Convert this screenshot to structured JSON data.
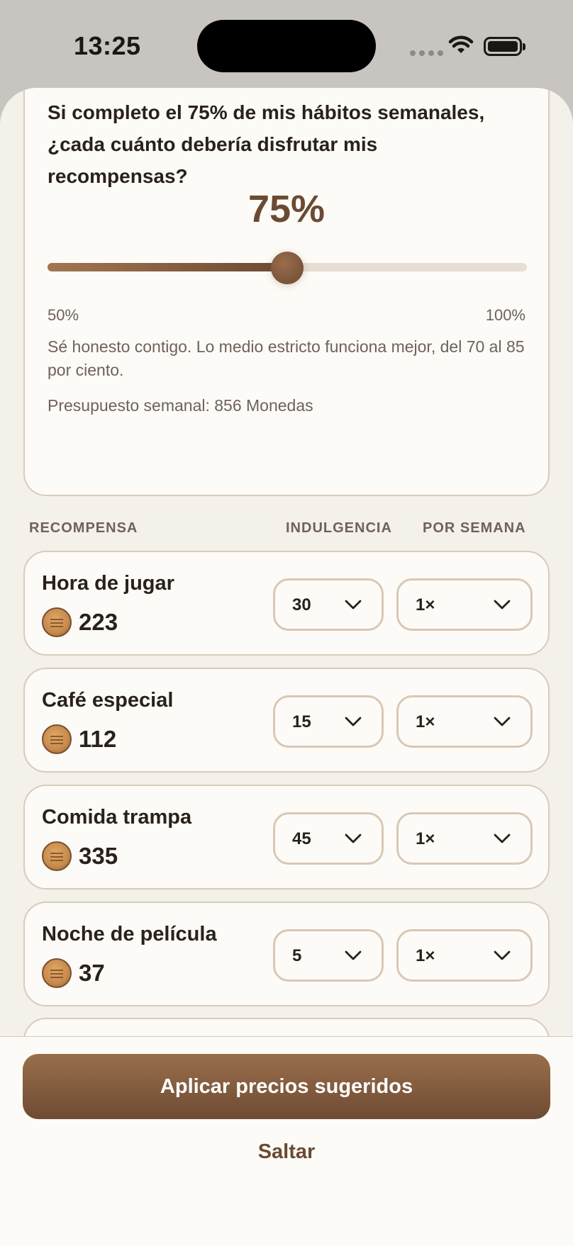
{
  "status_bar": {
    "time": "13:25"
  },
  "question_card": {
    "question": "Si completo el 75% de mis hábitos semanales, ¿cada cuánto debería disfrutar mis recompensas?",
    "percent_label": "75%",
    "slider": {
      "value": 75,
      "min": 50,
      "max": 100,
      "min_label": "50%",
      "max_label": "100%"
    },
    "hint": "Sé honesto contigo. Lo medio estricto funciona mejor, del 70 al 85 por ciento.",
    "budget": "Presupuesto semanal: 856 Monedas"
  },
  "table_headers": {
    "reward": "RECOMPENSA",
    "indulgence": "INDULGENCIA",
    "per_week": "POR SEMANA"
  },
  "rewards": [
    {
      "name": "Hora de jugar",
      "cost": "223",
      "indulgence": "30",
      "per_week": "1×"
    },
    {
      "name": "Café especial",
      "cost": "112",
      "indulgence": "15",
      "per_week": "1×"
    },
    {
      "name": "Comida trampa",
      "cost": "335",
      "indulgence": "45",
      "per_week": "1×"
    },
    {
      "name": "Noche de película",
      "cost": "37",
      "indulgence": "5",
      "per_week": "1×"
    }
  ],
  "actions": {
    "apply_label": "Aplicar precios sugeridos",
    "skip_label": "Saltar"
  },
  "colors": {
    "accent": "#6b4a33",
    "background": "#f4f0ea",
    "card": "#fdfbf7",
    "border": "#d9cbbb"
  },
  "icons": [
    "wifi-icon",
    "battery-icon",
    "coin-icon",
    "chevron-down-icon"
  ]
}
